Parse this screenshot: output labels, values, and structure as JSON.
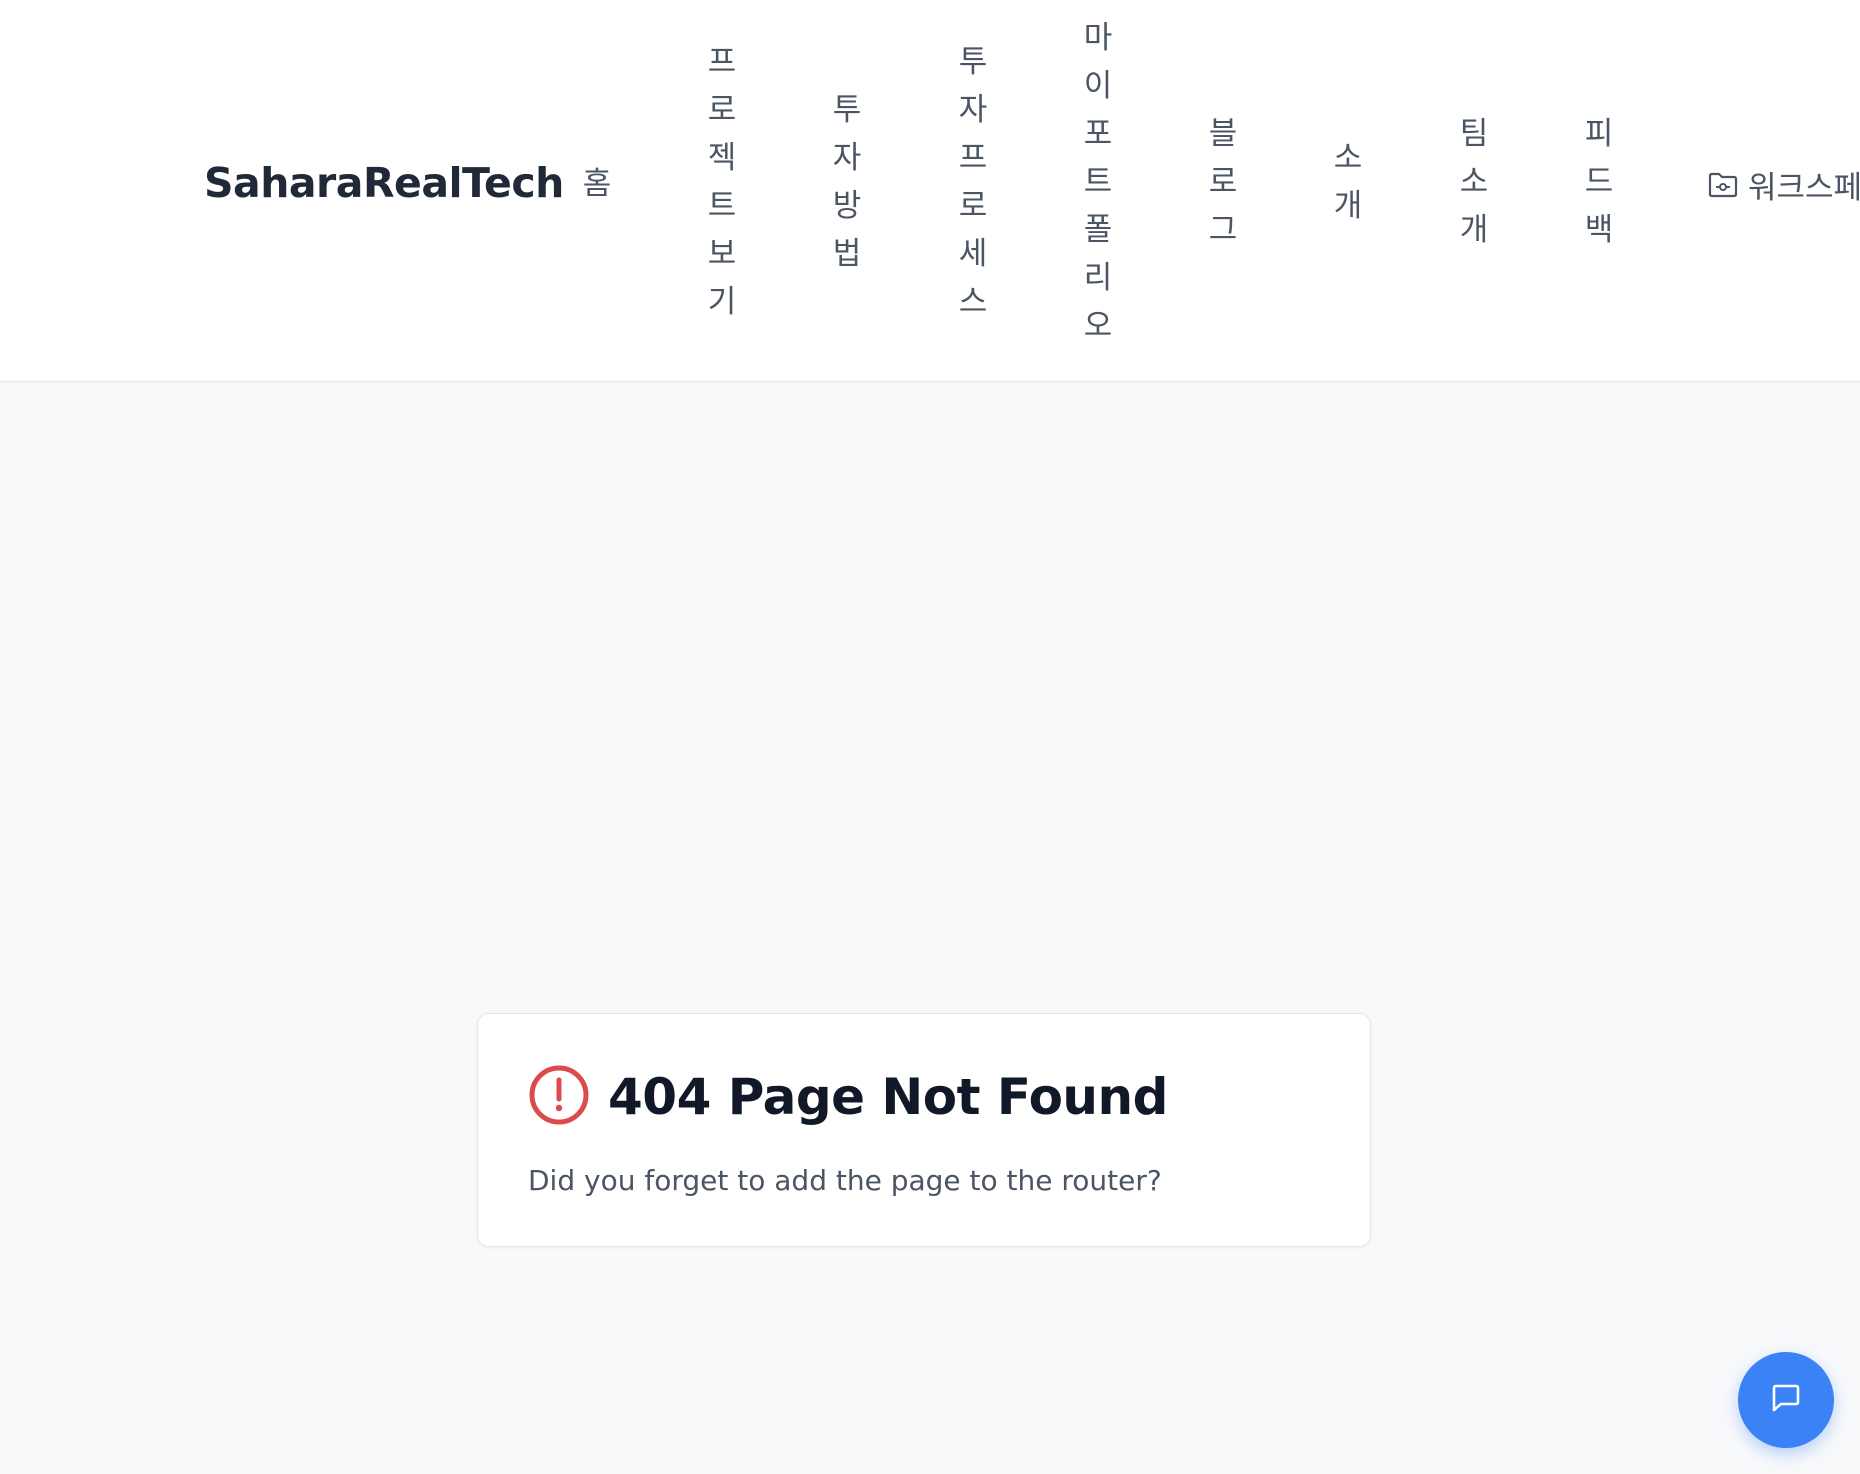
{
  "header": {
    "logo": "SaharaRealTech",
    "nav": [
      {
        "label": "홈"
      },
      {
        "label": "프로젝트보기"
      },
      {
        "label": "투자방법"
      },
      {
        "label": "투자프로세스"
      },
      {
        "label": "마이포트폴리오"
      },
      {
        "label": "블로그"
      },
      {
        "label": "소개"
      },
      {
        "label": "팀소개"
      },
      {
        "label": "피드백"
      }
    ],
    "workspace_label": "워크스페",
    "workspace_icon": "folder-icon"
  },
  "error": {
    "icon": "alert-circle-icon",
    "icon_color": "#dc4b4b",
    "title": "404 Page Not Found",
    "description": "Did you forget to add the page to the router?"
  },
  "chat": {
    "icon": "message-square-icon",
    "color": "#3b82f6"
  }
}
